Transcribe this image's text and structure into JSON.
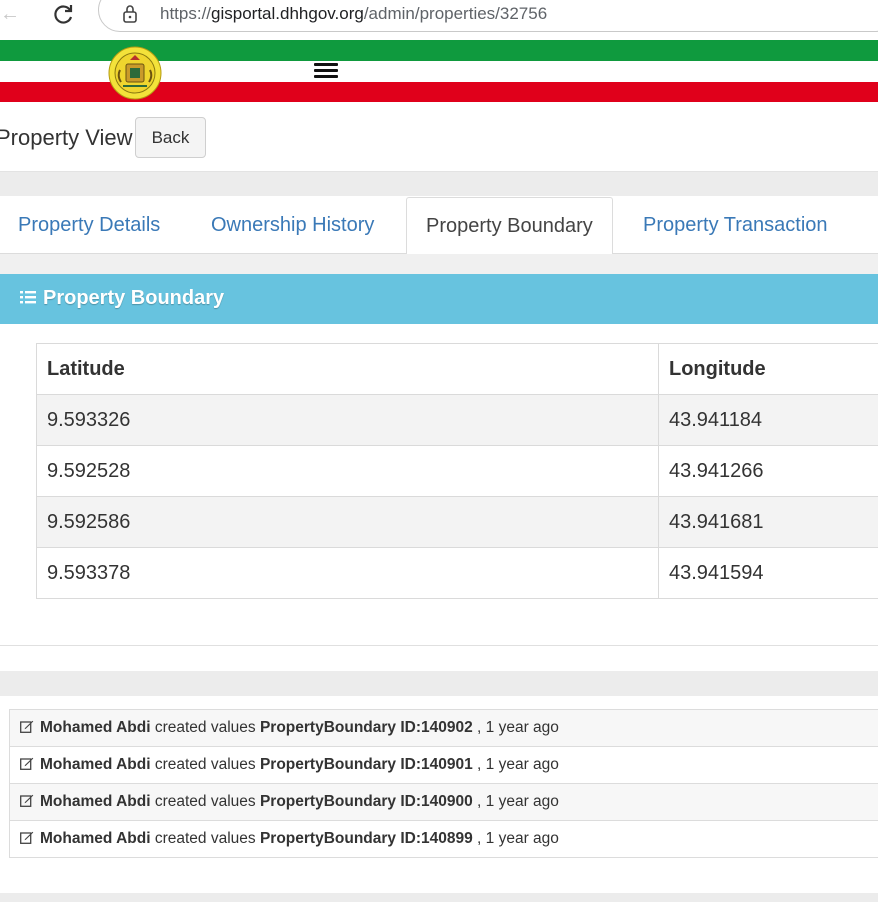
{
  "browser": {
    "url_prefix": "https://",
    "url_host": "gisportal.dhhgov.org",
    "url_path": "/admin/properties/32756"
  },
  "page": {
    "title": "Property View",
    "back_label": "Back"
  },
  "tabs": [
    {
      "label": "Property Details",
      "active": false
    },
    {
      "label": "Ownership History",
      "active": false
    },
    {
      "label": "Property Boundary",
      "active": true
    },
    {
      "label": "Property Transaction",
      "active": false
    }
  ],
  "panel": {
    "title": "Property Boundary",
    "columns": [
      "Latitude",
      "Longitude"
    ],
    "rows": [
      [
        "9.593326",
        "43.941184"
      ],
      [
        "9.592528",
        "43.941266"
      ],
      [
        "9.592586",
        "43.941681"
      ],
      [
        "9.593378",
        "43.941594"
      ]
    ]
  },
  "activity": [
    {
      "user": "Mohamed Abdi",
      "action": "created values",
      "target": "PropertyBoundary ID:140902",
      "time": ", 1 year ago"
    },
    {
      "user": "Mohamed Abdi",
      "action": "created values",
      "target": "PropertyBoundary ID:140901",
      "time": ", 1 year ago"
    },
    {
      "user": "Mohamed Abdi",
      "action": "created values",
      "target": "PropertyBoundary ID:140900",
      "time": ", 1 year ago"
    },
    {
      "user": "Mohamed Abdi",
      "action": "created values",
      "target": "PropertyBoundary ID:140899",
      "time": ", 1 year ago"
    }
  ],
  "colors": {
    "flag_green": "#0f9a3e",
    "flag_red": "#e0001b",
    "panel_header": "#67c3df",
    "tab_link": "#3a79b7"
  },
  "icons": [
    "back-arrow-icon",
    "reload-icon",
    "lock-icon",
    "emblem-logo",
    "hamburger-menu-icon",
    "list-icon",
    "edit-icon"
  ]
}
